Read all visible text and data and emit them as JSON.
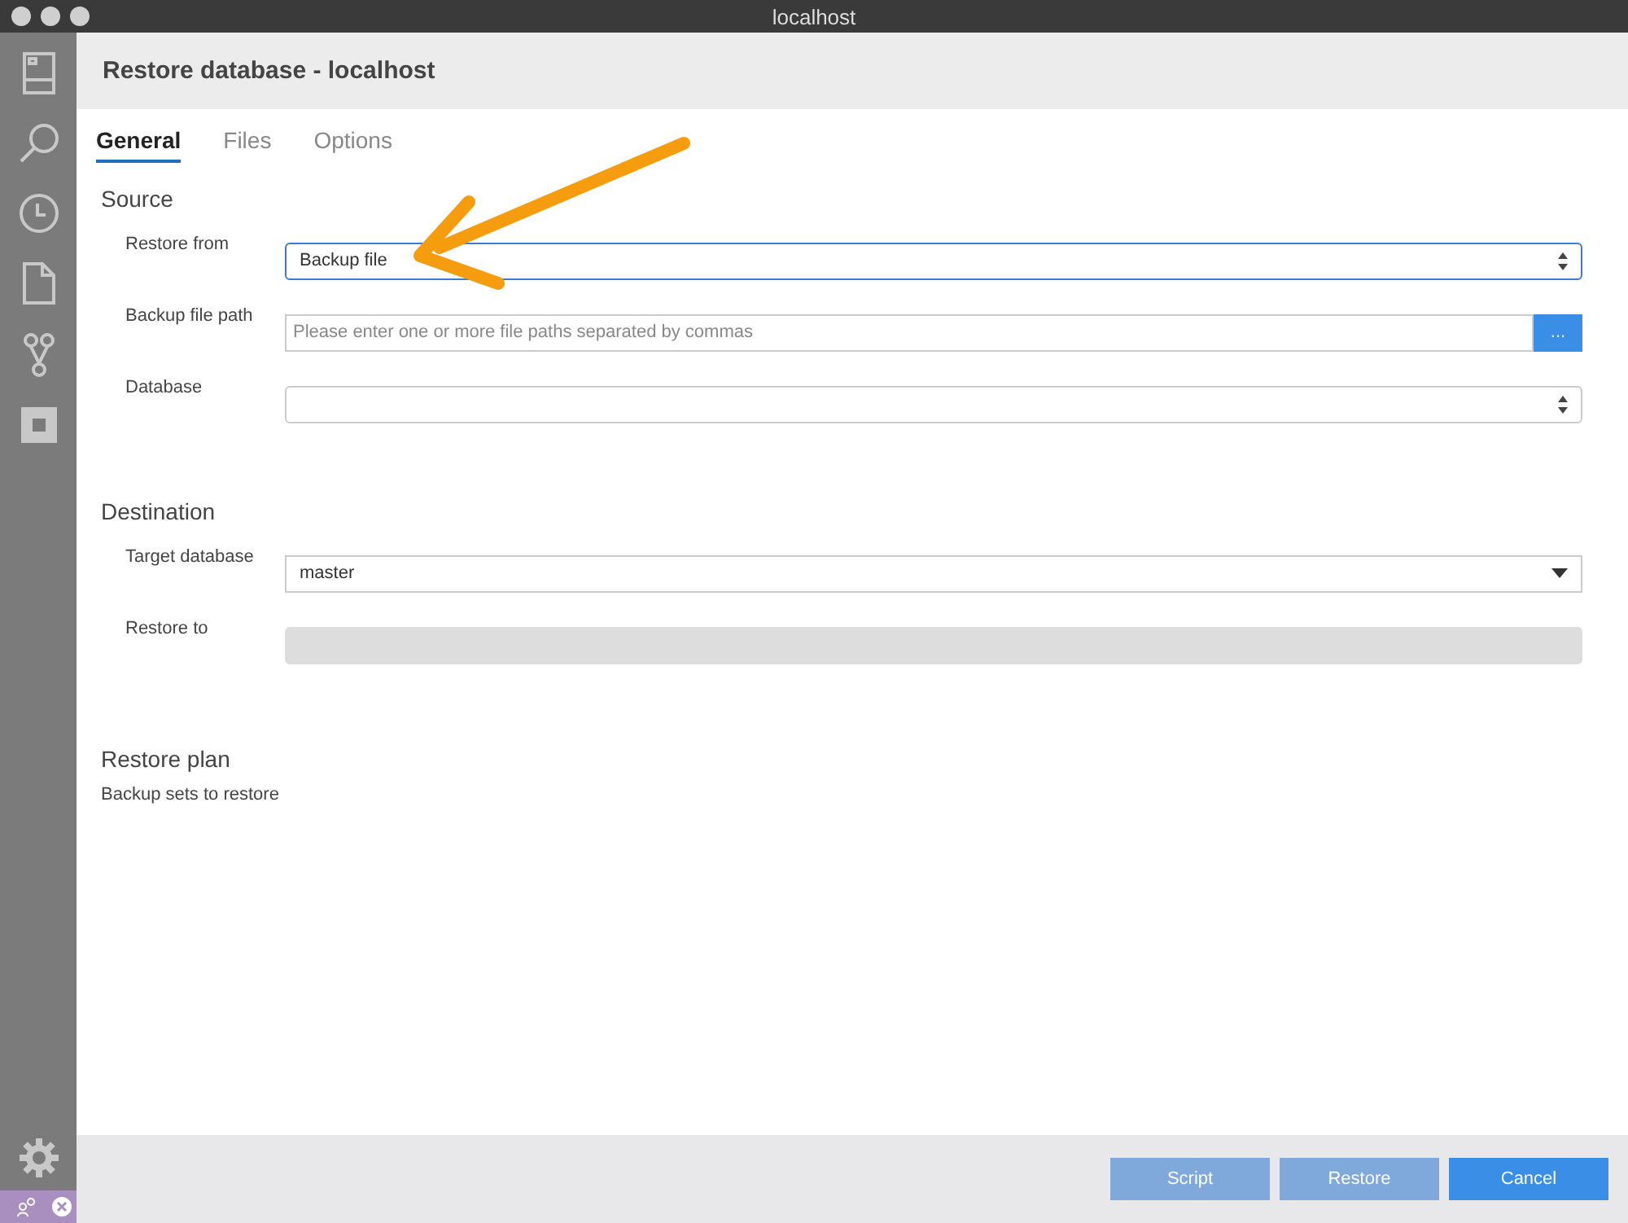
{
  "window": {
    "title": "localhost"
  },
  "dialog": {
    "title": "Restore database - localhost"
  },
  "tabs": [
    {
      "label": "General",
      "selected": true
    },
    {
      "label": "Files",
      "selected": false
    },
    {
      "label": "Options",
      "selected": false
    }
  ],
  "sections": [
    {
      "title": "Source",
      "fields": [
        {
          "label": "Restore from",
          "kind": "stepper",
          "value": "Backup file",
          "focused": true
        },
        {
          "label": "Backup file path",
          "kind": "browse",
          "placeholder": "Please enter one or more file paths separated by commas",
          "button": "..."
        },
        {
          "label": "Database",
          "kind": "stepper"
        }
      ]
    },
    {
      "title": "Destination",
      "fields": [
        {
          "label": "Target database",
          "kind": "dropdown",
          "value": "master"
        },
        {
          "label": "Restore to",
          "kind": "disabled"
        }
      ]
    },
    {
      "title": "Restore plan",
      "note": "Backup sets to restore"
    }
  ],
  "buttons": [
    {
      "label": "Script",
      "disabled": true
    },
    {
      "label": "Restore",
      "disabled": true
    },
    {
      "label": "Cancel",
      "disabled": false
    }
  ]
}
